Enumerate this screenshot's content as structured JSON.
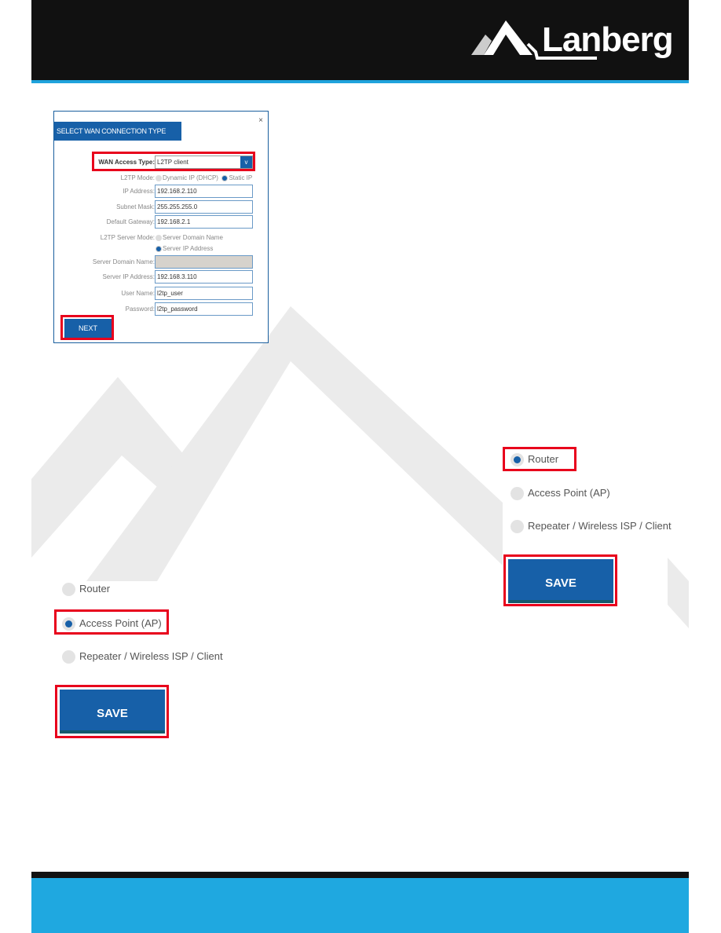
{
  "header": {
    "brand": "Lanberg",
    "colors": {
      "bar": "#111111",
      "accent": "#1fa3dc"
    }
  },
  "dialog": {
    "title": "SELECT WAN CONNECTION TYPE",
    "close": "×",
    "wan_access_type": {
      "label": "WAN Access Type:",
      "value": "L2TP client"
    },
    "l2tp_mode": {
      "label": "L2TP Mode:",
      "options": [
        "Dynamic IP (DHCP)",
        "Static IP"
      ],
      "selected": "Static IP"
    },
    "ip_address": {
      "label": "IP Address:",
      "value": "192.168.2.110"
    },
    "subnet_mask": {
      "label": "Subnet Mask:",
      "value": "255.255.255.0"
    },
    "default_gateway": {
      "label": "Default Gateway:",
      "value": "192.168.2.1"
    },
    "server_mode": {
      "label": "L2TP Server Mode:",
      "options": [
        "Server Domain Name",
        "Server IP Address"
      ],
      "selected": "Server IP Address"
    },
    "server_domain": {
      "label": "Server Domain Name:",
      "value": ""
    },
    "server_ip": {
      "label": "Server IP Address:",
      "value": "192.168.3.110"
    },
    "user_name": {
      "label": "User Name:",
      "value": "l2tp_user"
    },
    "password": {
      "label": "Password:",
      "value": "l2tp_password"
    },
    "next": "NEXT"
  },
  "mode_right": {
    "options": [
      "Router",
      "Access Point (AP)",
      "Repeater / Wireless ISP / Client"
    ],
    "selected": "Router",
    "save": "SAVE"
  },
  "mode_left": {
    "options": [
      "Router",
      "Access Point (AP)",
      "Repeater / Wireless ISP / Client"
    ],
    "selected": "Access Point (AP)",
    "save": "SAVE"
  }
}
